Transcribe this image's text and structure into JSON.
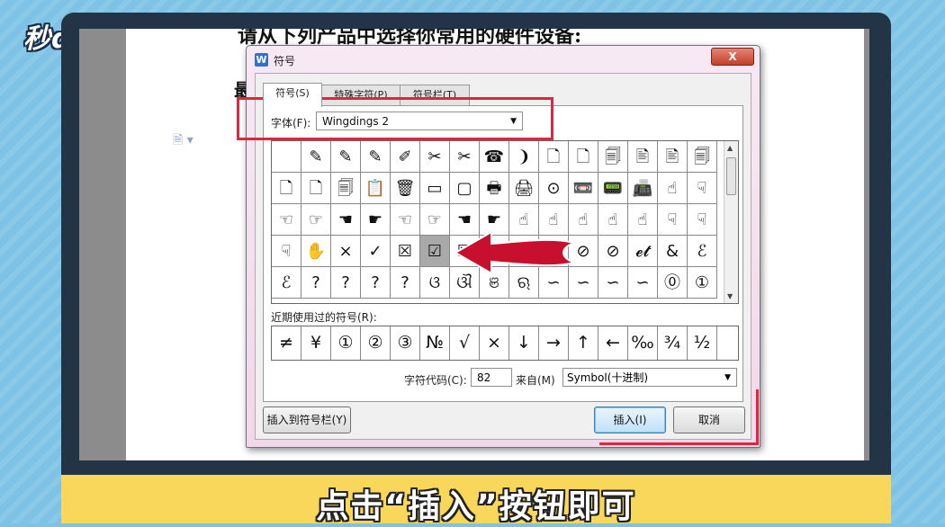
{
  "watermark": "秒dong视频",
  "caption": "点击“插入”按钮即可",
  "document": {
    "line1": "请从下列产品中选择你常用的硬件设备:",
    "line2": "最"
  },
  "dialog": {
    "title": "符号",
    "close_label": "X",
    "tabs": [
      "符号(S)",
      "特殊字符(P)",
      "符号栏(T)"
    ],
    "font_label": "字体(F):",
    "font_value": "Wingdings 2",
    "symbol_rows": [
      [
        "",
        "✎",
        "✎",
        "✎",
        "✐",
        "✂",
        "✂",
        "☎",
        "❩",
        "🗋",
        "🗋",
        "🗐",
        "🖹",
        "🖹",
        "🗐"
      ],
      [
        "🗋",
        "🗋",
        "🗐",
        "📋",
        "🗑",
        "▭",
        "▢",
        "🖶",
        "🖨",
        "⊙",
        "📼",
        "📟",
        "📠",
        "☝",
        "☟"
      ],
      [
        "☜",
        "☞",
        "☚",
        "☛",
        "☜",
        "☞",
        "☚",
        "☛",
        "☝",
        "☝",
        "☝",
        "☝",
        "☝",
        "☟",
        "☟"
      ],
      [
        "☟",
        "✋",
        "×",
        "✓",
        "☒",
        "☑",
        "☒",
        "☒",
        "⊗",
        "⊗",
        "⊘",
        "⊘",
        "𝓮𝓽",
        "&",
        "ℰ"
      ],
      [
        "ℰ",
        "?",
        "?",
        "?",
        "?",
        "ଓ",
        "ଔ",
        "ଞ",
        "ଋ",
        "∽",
        "∽",
        "∽",
        "∽",
        "⓪",
        "①"
      ]
    ],
    "selected_symbol": "☑",
    "recent_label": "近期使用过的符号(R):",
    "recent_symbols": [
      "≠",
      "¥",
      "①",
      "②",
      "③",
      "№",
      "√",
      "×",
      "↓",
      "→",
      "↑",
      "←",
      "‰",
      "¾",
      "½"
    ],
    "code_label": "字符代码(C):",
    "code_value": "82",
    "source_label": "来自(M)",
    "source_value": "Symbol(十进制)",
    "insert_to_bar_button": "插入到符号栏(Y)",
    "insert_button": "插入(I)",
    "cancel_button": "取消"
  },
  "colors": {
    "highlight_red": "#e0263f",
    "arrow_red": "#c8102e"
  }
}
